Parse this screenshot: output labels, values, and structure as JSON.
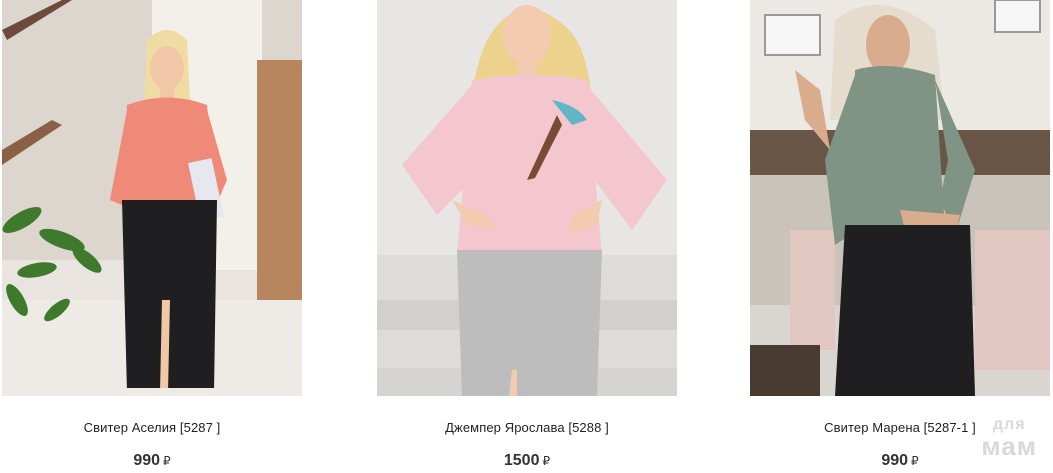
{
  "products": [
    {
      "name": "Свитер Аселия [5287 ]",
      "price": "990",
      "currency": "₽",
      "photo": "model-coral-sweater-black-leather-skirt"
    },
    {
      "name": "Джемпер Ярослава [5288 ]",
      "price": "1500",
      "currency": "₽",
      "photo": "model-pink-sweatshirt-grey-skirt"
    },
    {
      "name": "Свитер Марена [5287-1 ]",
      "price": "990",
      "currency": "₽",
      "photo": "model-grey-green-sweater-black-leather-skirt"
    }
  ],
  "watermark": {
    "line1": "для",
    "line2": "мам"
  },
  "colors": {
    "coral": "#f08a78",
    "pink": "#f4c7cf",
    "olive": "#7f9484",
    "leather": "#1f1f21",
    "grey_skirt": "#bdbdbd"
  }
}
